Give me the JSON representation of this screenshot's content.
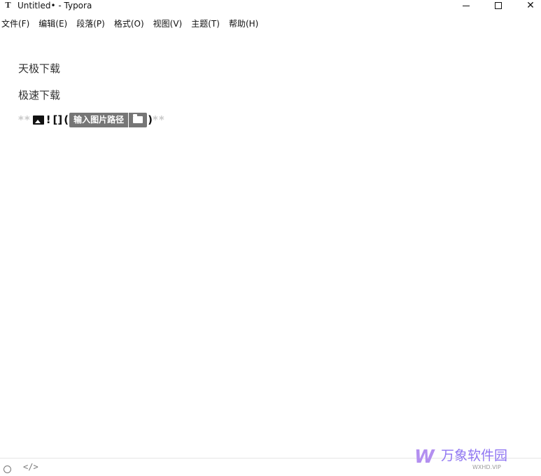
{
  "window": {
    "icon_letter": "T",
    "title": "Untitled• - Typora",
    "minimize_symbol": "",
    "close_symbol": "✕"
  },
  "menu": [
    "文件(F)",
    "编辑(E)",
    "段落(P)",
    "格式(O)",
    "视图(V)",
    "主题(T)",
    "帮助(H)"
  ],
  "editor": {
    "paragraphs": [
      "天极下载",
      "极速下载"
    ],
    "markdown_line": {
      "stars_open": "**",
      "bang": "!",
      "brackets": "[]",
      "paren_open": "(",
      "path_placeholder": "输入图片路径",
      "paren_close": ")",
      "stars_close": "**"
    }
  },
  "statusbar": {
    "code_toggle": "</>"
  },
  "watermark": {
    "logo": "W",
    "name": "万象软件园",
    "url": "WXHD.VIP"
  },
  "colors": {
    "path_input_bg": "#767676",
    "md_marker": "#c9c9c9",
    "watermark_purple": "#8f75f2"
  }
}
